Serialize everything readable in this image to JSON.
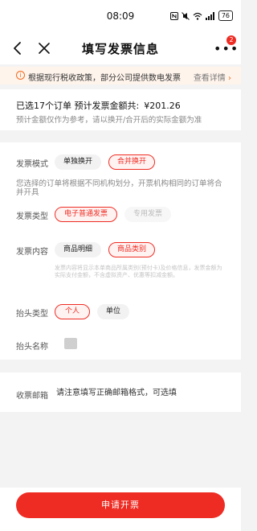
{
  "status_bar": {
    "time": "08:09",
    "icons": [
      "nfc-icon",
      "mute-icon",
      "wifi-icon",
      "signal-icon"
    ],
    "signal_text": "4G",
    "battery": "76"
  },
  "nav": {
    "title": "填写发票信息",
    "more_badge": "2"
  },
  "notice": {
    "text": "根据现行税收政策，部分公司提供数电发票",
    "link": "查看详情",
    "link_chevron": "›",
    "info_glyph": "i"
  },
  "summary": {
    "line1_prefix": "已选17个订单 预计发票金额共:",
    "amount": "¥201.26",
    "line2": "预计金额仅作为参考，请以换开/合开后的实际金额为准"
  },
  "form": {
    "mode": {
      "label": "发票模式",
      "options": [
        "单独换开",
        "合并换开"
      ],
      "selected": "合并换开",
      "description": "您选择的订单将根据不同机构划分，开票机构相同的订单将合并开具"
    },
    "type": {
      "label": "发票类型",
      "options": [
        "电子普通发票",
        "专用发票"
      ],
      "selected": "电子普通发票",
      "disabled": "专用发票"
    },
    "content": {
      "label": "发票内容",
      "options": [
        "商品明细",
        "商品类别"
      ],
      "selected": "商品类别",
      "fine_print": "发票内容将显示本单商品所属类别(预付卡)及价格信息，发票金额为实际支付金额，不含虚拟资产、优惠等扣减金额。"
    },
    "title_type": {
      "label": "抬头类型",
      "options": [
        "个人",
        "单位"
      ],
      "selected": "个人"
    },
    "title_name": {
      "label": "抬头名称",
      "value": ""
    }
  },
  "email": {
    "label": "收票邮箱",
    "placeholder": "请注意填写正确邮箱格式，可选填"
  },
  "submit_label": "申请开票",
  "colors": {
    "accent": "#ee2c23",
    "notice_bg": "#fff4ec",
    "notice_icon": "#f26a1f"
  }
}
